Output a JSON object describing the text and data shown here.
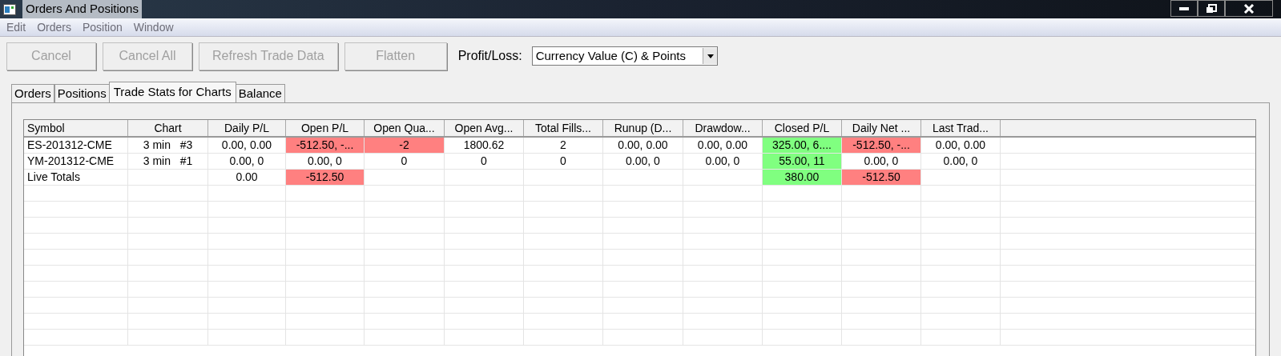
{
  "window": {
    "title": "Orders And Positions"
  },
  "menu": [
    "Edit",
    "Orders",
    "Position",
    "Window"
  ],
  "buttons": [
    {
      "label": "Cancel",
      "disabled": true
    },
    {
      "label": "Cancel All",
      "disabled": true
    },
    {
      "label": "Refresh Trade Data",
      "disabled": true
    },
    {
      "label": "Flatten",
      "disabled": true
    }
  ],
  "profit_loss": {
    "label": "Profit/Loss:",
    "value": "Currency Value (C) & Points"
  },
  "tabs": [
    {
      "label": "Orders",
      "selected": false
    },
    {
      "label": "Positions",
      "selected": false
    },
    {
      "label": "Trade Stats for Charts",
      "selected": true
    },
    {
      "label": "Balance",
      "selected": false
    }
  ],
  "table": {
    "columns": [
      "Symbol",
      "Chart",
      "Daily P/L",
      "Open P/L",
      "Open Qua...",
      "Open Avg...",
      "Total Fills...",
      "Runup (D...",
      "Drawdow...",
      "Closed P/L",
      "Daily Net ...",
      "Last Trad..."
    ],
    "rows": [
      [
        {
          "text": "ES-201312-CME"
        },
        {
          "text": "3 min   #3"
        },
        {
          "text": "0.00, 0.00"
        },
        {
          "text": "-512.50, -...",
          "color": "#ff8080"
        },
        {
          "text": "-2",
          "color": "#ff8080"
        },
        {
          "text": "1800.62"
        },
        {
          "text": "2"
        },
        {
          "text": "0.00, 0.00"
        },
        {
          "text": "0.00, 0.00"
        },
        {
          "text": "325.00, 6....",
          "color": "#80ff80"
        },
        {
          "text": "-512.50, -...",
          "color": "#ff8080"
        },
        {
          "text": "0.00, 0.00"
        }
      ],
      [
        {
          "text": "YM-201312-CME"
        },
        {
          "text": "3 min   #1"
        },
        {
          "text": "0.00, 0"
        },
        {
          "text": "0.00, 0"
        },
        {
          "text": "0"
        },
        {
          "text": "0"
        },
        {
          "text": "0"
        },
        {
          "text": "0.00, 0"
        },
        {
          "text": "0.00, 0"
        },
        {
          "text": "55.00, 11",
          "color": "#80ff80"
        },
        {
          "text": "0.00, 0"
        },
        {
          "text": "0.00, 0"
        }
      ],
      [
        {
          "text": "Live Totals"
        },
        {
          "text": ""
        },
        {
          "text": "0.00"
        },
        {
          "text": "-512.50",
          "color": "#ff8080"
        },
        {
          "text": ""
        },
        {
          "text": ""
        },
        {
          "text": ""
        },
        {
          "text": ""
        },
        {
          "text": ""
        },
        {
          "text": "380.00",
          "color": "#80ff80"
        },
        {
          "text": "-512.50",
          "color": "#ff8080"
        },
        {
          "text": ""
        }
      ]
    ]
  }
}
